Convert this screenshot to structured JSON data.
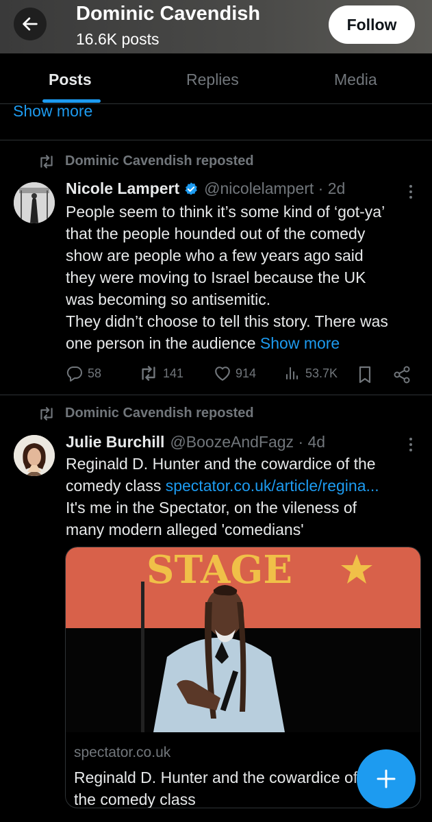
{
  "header": {
    "name": "Dominic Cavendish",
    "posts_count": "16.6K posts",
    "follow_label": "Follow"
  },
  "tabs": [
    {
      "label": "Posts",
      "active": true
    },
    {
      "label": "Replies",
      "active": false
    },
    {
      "label": "Media",
      "active": false
    }
  ],
  "top_show_more": "Show more",
  "posts": [
    {
      "repost_label": "Dominic Cavendish reposted",
      "author_name": "Nicole Lampert",
      "verified": true,
      "handle_time": "@nicolelampert · 2d",
      "text_lines": [
        "People seem to think it’s some kind of ‘got-ya’",
        "that the people hounded out of the comedy",
        "show are people who a few years ago said",
        "they were moving to Israel because the UK",
        "was becoming so antisemitic.",
        "They didn’t choose to tell this story. There was",
        "one person in the audience"
      ],
      "show_more": "Show more",
      "replies": "58",
      "reposts": "141",
      "likes": "914",
      "views": "53.7K"
    },
    {
      "repost_label": "Dominic Cavendish reposted",
      "author_name": "Julie Burchill",
      "verified": false,
      "handle_time": "@BoozeAndFagz · 4d",
      "line1": "Reginald D. Hunter and the cowardice of the",
      "line2_text": "comedy class",
      "line2_link": "spectator.co.uk/article/regina...",
      "line3": "It's me in the Spectator, on the vileness of",
      "line4": "many modern alleged 'comedians'",
      "card": {
        "image_sign_text": "STAGE",
        "domain": "spectator.co.uk",
        "title": "Reginald D. Hunter and the cowardice of the comedy class"
      }
    }
  ],
  "colors": {
    "accent": "#1d9bf0",
    "background": "#000000",
    "muted": "#71767b"
  }
}
